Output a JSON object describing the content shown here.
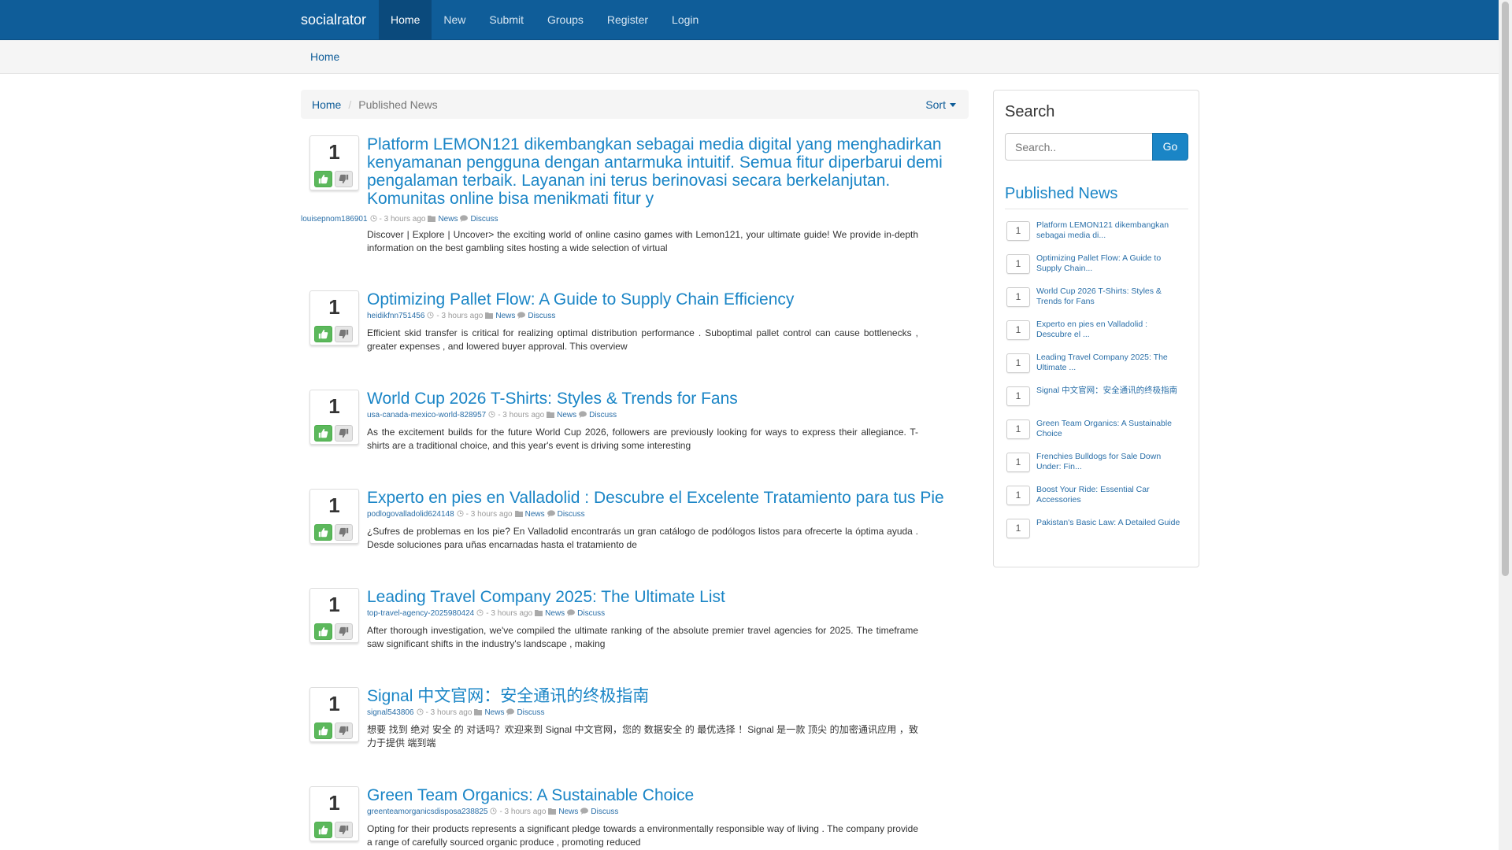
{
  "navbar": {
    "brand": "socialrator",
    "items": [
      {
        "label": "Home",
        "active": true
      },
      {
        "label": "New"
      },
      {
        "label": "Submit"
      },
      {
        "label": "Groups"
      },
      {
        "label": "Register"
      },
      {
        "label": "Login"
      }
    ]
  },
  "subbar": {
    "home": "Home"
  },
  "breadcrumb": {
    "home": "Home",
    "current": "Published News",
    "sort": "Sort"
  },
  "posts": [
    {
      "votes": "1",
      "title": "Platform LEMON121 dikembangkan sebagai media digital yang menghadirkan kenyamanan pengguna dengan antarmuka intuitif. Semua fitur diperbarui demi pengalaman terbaik. Layanan ini terus berinovasi secara berkelanjutan. Komunitas online bisa menikmati fitur y",
      "user": "louisepnom186901",
      "time": "- 3 hours ago",
      "category": "News",
      "discuss": "Discuss",
      "excerpt": "Discover | Explore | Uncover> the exciting world of online casino games with Lemon121, your ultimate guide! We provide in-depth information on the best gambling sites hosting a wide selection of virtual"
    },
    {
      "votes": "1",
      "title": "Optimizing Pallet Flow: A Guide to Supply Chain Efficiency",
      "user": "heidikfnn751456",
      "time": "- 3 hours ago",
      "category": "News",
      "discuss": "Discuss",
      "excerpt": "Efficient skid transfer is critical for realizing optimal distribution performance . Suboptimal pallet control can cause bottlenecks , greater expenses , and lowered buyer approval. This overview"
    },
    {
      "votes": "1",
      "title": "World Cup 2026 T-Shirts: Styles & Trends for Fans",
      "user": "usa-canada-mexico-world-828957",
      "time": "- 3 hours ago",
      "category": "News",
      "discuss": "Discuss",
      "excerpt": "As the excitement builds for the future World Cup 2026, followers are previously looking for ways to express their allegiance. T-shirts are a traditional choice, and this year's event is driving some interesting"
    },
    {
      "votes": "1",
      "title": "Experto en pies en Valladolid : Descubre el Excelente Tratamiento para tus Pie",
      "user": "podlogovalladolid624148",
      "time": "- 3 hours ago",
      "category": "News",
      "discuss": "Discuss",
      "excerpt": "¿Sufres de problemas en los pie? En Valladolid encontrarás un gran catálogo de podólogos listos para ofrecerte la óptima ayuda . Desde soluciones para uñas encarnadas hasta el tratamiento de"
    },
    {
      "votes": "1",
      "title": "Leading Travel Company 2025: The Ultimate List",
      "user": "top-travel-agency-2025980424",
      "time": "- 3 hours ago",
      "category": "News",
      "discuss": "Discuss",
      "excerpt": "After thorough investigation, we've compiled the ultimate ranking of the absolute premier travel agencies for 2025. The timeframe saw significant shifts in the industry's landscape , making"
    },
    {
      "votes": "1",
      "title": "Signal 中文官网：安全通讯的终极指南",
      "user": "signal543806",
      "time": "- 3 hours ago",
      "category": "News",
      "discuss": "Discuss",
      "excerpt": "想要 找到 绝对 安全 的 对话吗？欢迎来到 Signal 中文官网，您的 数据安全 的 最优选择 ！Signal 是一款 顶尖 的加密通讯应用 ，致力于提供 端到端"
    },
    {
      "votes": "1",
      "title": "Green Team Organics: A Sustainable Choice",
      "user": "greenteamorganicsdisposa238825",
      "time": "- 3 hours ago",
      "category": "News",
      "discuss": "Discuss",
      "excerpt": "Opting for their products represents a significant pledge towards a environmentally responsible way of living . The company provide a range of carefully sourced organic produce , promoting reduced"
    }
  ],
  "sidebar": {
    "search_title": "Search",
    "search_placeholder": "Search..",
    "go_label": "Go",
    "published_title": "Published News",
    "items": [
      {
        "count": "1",
        "label": "Platform LEMON121 dikembangkan sebagai media di..."
      },
      {
        "count": "1",
        "label": "Optimizing Pallet Flow: A Guide to Supply Chain..."
      },
      {
        "count": "1",
        "label": "World Cup 2026 T-Shirts: Styles & Trends for Fans"
      },
      {
        "count": "1",
        "label": "Experto en pies en Valladolid : Descubre el ..."
      },
      {
        "count": "1",
        "label": "Leading Travel Company 2025: The Ultimate ..."
      },
      {
        "count": "1",
        "label": "Signal 中文官网：安全通讯的终极指南"
      },
      {
        "count": "1",
        "label": "Green Team Organics: A Sustainable Choice"
      },
      {
        "count": "1",
        "label": "Frenchies Bulldogs for Sale Down Under: Fin..."
      },
      {
        "count": "1",
        "label": "Boost Your Ride: Essential Car Accessories"
      },
      {
        "count": "1",
        "label": "Pakistan's Basic Law: A Detailed Guide"
      }
    ]
  }
}
